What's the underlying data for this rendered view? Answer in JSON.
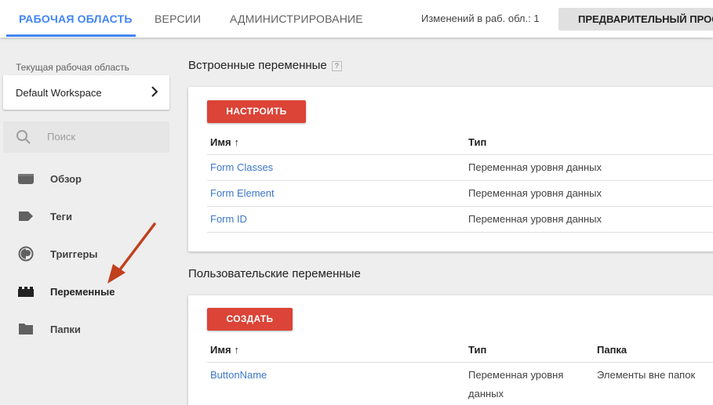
{
  "topbar": {
    "tabs": [
      {
        "label": "Рабочая область",
        "active": true
      },
      {
        "label": "Версии",
        "active": false
      },
      {
        "label": "Администрирование",
        "active": false
      }
    ],
    "changes": "Изменений в раб. обл.: 1",
    "preview_label": "Предварительный просмотр"
  },
  "sidebar": {
    "workspace_label": "Текущая рабочая область",
    "workspace_name": "Default Workspace",
    "search_placeholder": "Поиск",
    "items": [
      {
        "label": "Обзор",
        "icon": "briefcase-icon"
      },
      {
        "label": "Теги",
        "icon": "tag-icon"
      },
      {
        "label": "Триггеры",
        "icon": "trigger-icon"
      },
      {
        "label": "Переменные",
        "icon": "variable-brick-icon",
        "active": true
      },
      {
        "label": "Папки",
        "icon": "folder-icon"
      }
    ]
  },
  "builtin": {
    "title": "Встроенные переменные",
    "help": "?",
    "button": "Настроить",
    "col_name": "Имя",
    "col_type": "Тип",
    "sort_arrow": "↑",
    "rows": [
      {
        "name": "Form Classes",
        "type": "Переменная уровня данных"
      },
      {
        "name": "Form Element",
        "type": "Переменная уровня данных"
      },
      {
        "name": "Form ID",
        "type": "Переменная уровня данных"
      }
    ]
  },
  "custom": {
    "title": "Пользовательские переменные",
    "button": "Создать",
    "col_name": "Имя",
    "col_type": "Тип",
    "col_folder": "Папка",
    "sort_arrow": "↑",
    "rows": [
      {
        "name": "ButtonName",
        "type_line1": "Переменная уровня",
        "type_line2": "данных",
        "folder": "Элементы вне папок"
      }
    ]
  },
  "colors": {
    "accent": "#4285f4",
    "button_red": "#db4437",
    "link": "#3d77c9",
    "annotation_arrow": "#c0401e"
  }
}
